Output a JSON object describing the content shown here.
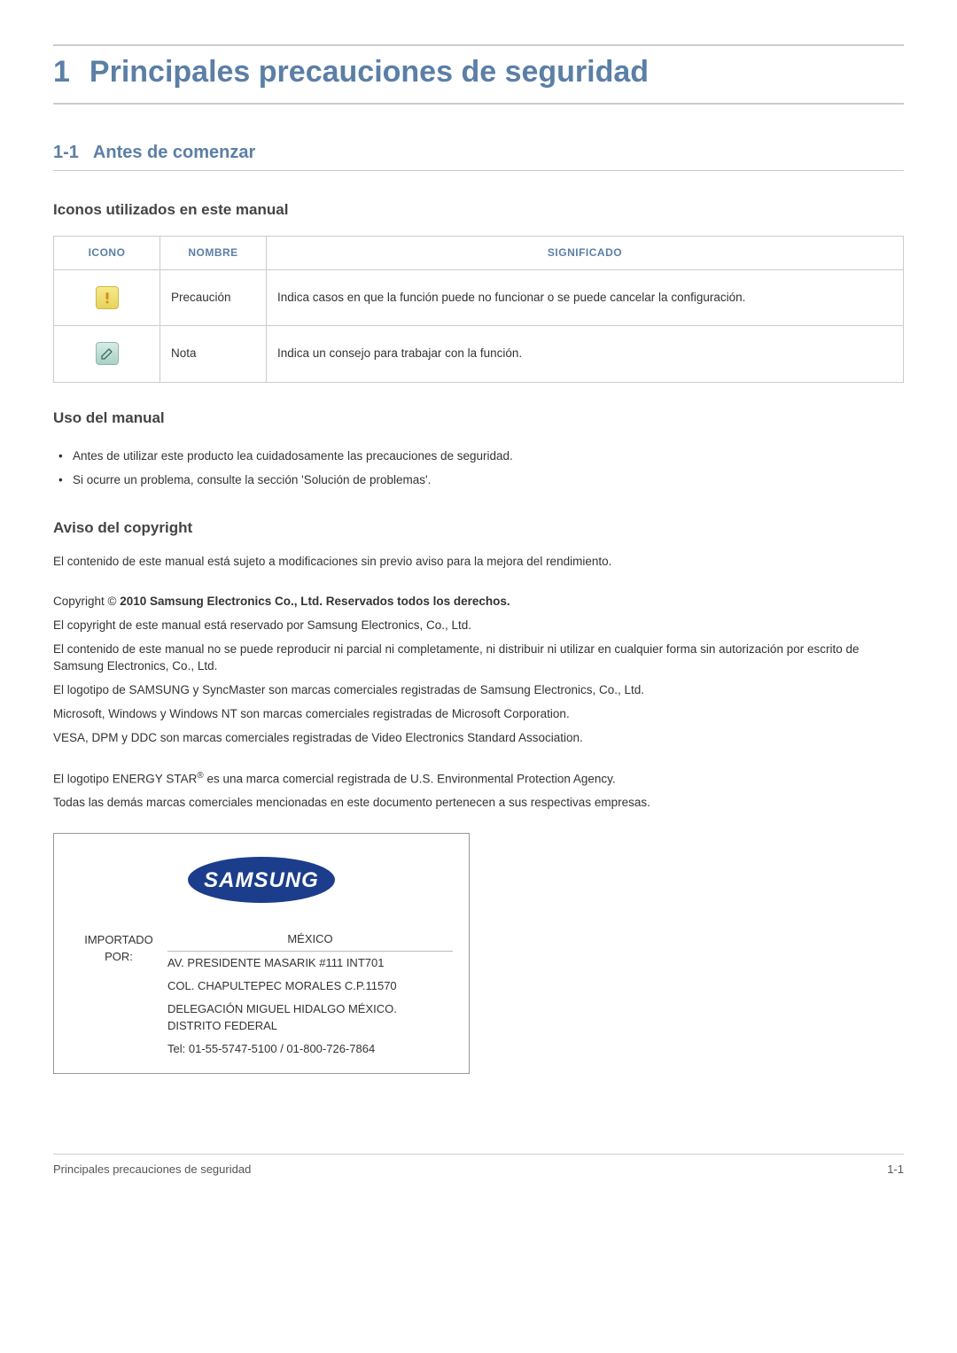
{
  "h1": {
    "num": "1",
    "title": "Principales precauciones de seguridad"
  },
  "h2": {
    "num": "1-1",
    "title": "Antes de comenzar"
  },
  "section_icons": {
    "heading": "Iconos utilizados en este manual",
    "cols": {
      "icon": "ICONO",
      "name": "NOMBRE",
      "meaning": "SIGNIFICADO"
    },
    "rows": [
      {
        "icon": "caution",
        "name": "Precaución",
        "meaning": "Indica casos en que la función puede no funcionar o se puede cancelar la configuración."
      },
      {
        "icon": "note",
        "name": "Nota",
        "meaning": "Indica un consejo para trabajar con la función."
      }
    ]
  },
  "section_use": {
    "heading": "Uso del manual",
    "items": [
      "Antes de utilizar este producto lea cuidadosamente las precauciones de seguridad.",
      "Si ocurre un problema, consulte la sección 'Solución de problemas'."
    ]
  },
  "section_copyright": {
    "heading": "Aviso del copyright",
    "p1": "El contenido de este manual está sujeto a modificaciones sin previo aviso para la mejora del rendimiento.",
    "copyright_prefix": "Copyright © ",
    "copyright_bold": "2010 Samsung Electronics Co., Ltd. Reservados todos los derechos.",
    "p2": "El copyright de este manual está reservado por Samsung Electronics, Co., Ltd.",
    "p3": "El contenido de este manual no se puede reproducir ni parcial ni completamente, ni distribuir ni utilizar en cualquier forma sin autorización por escrito de Samsung Electronics, Co., Ltd.",
    "p4": "El logotipo de SAMSUNG y SyncMaster son marcas comerciales registradas de Samsung Electronics, Co., Ltd.",
    "p5": "Microsoft, Windows y Windows NT son marcas comerciales registradas de Microsoft Corporation.",
    "p6": "VESA, DPM y DDC son marcas comerciales registradas de Video Electronics Standard Association.",
    "energy_star_pre": "El logotipo ENERGY STAR",
    "energy_star_sup": "®",
    "energy_star_post": " es una marca comercial registrada de U.S. Environmental Protection Agency.",
    "p8": "Todas las demás marcas comerciales mencionadas en este documento pertenecen a sus respectivas empresas."
  },
  "importer": {
    "logo_text": "SAMSUNG",
    "label": "IMPORTADO POR:",
    "country": "MÉXICO",
    "lines": [
      "AV. PRESIDENTE MASARIK #111 INT701",
      "COL. CHAPULTEPEC MORALES C.P.11570",
      "DELEGACIÓN MIGUEL HIDALGO MÉXICO. DISTRITO FEDERAL",
      "Tel: 01-55-5747-5100 / 01-800-726-7864"
    ]
  },
  "footer": {
    "left": "Principales precauciones de seguridad",
    "right": "1-1"
  }
}
